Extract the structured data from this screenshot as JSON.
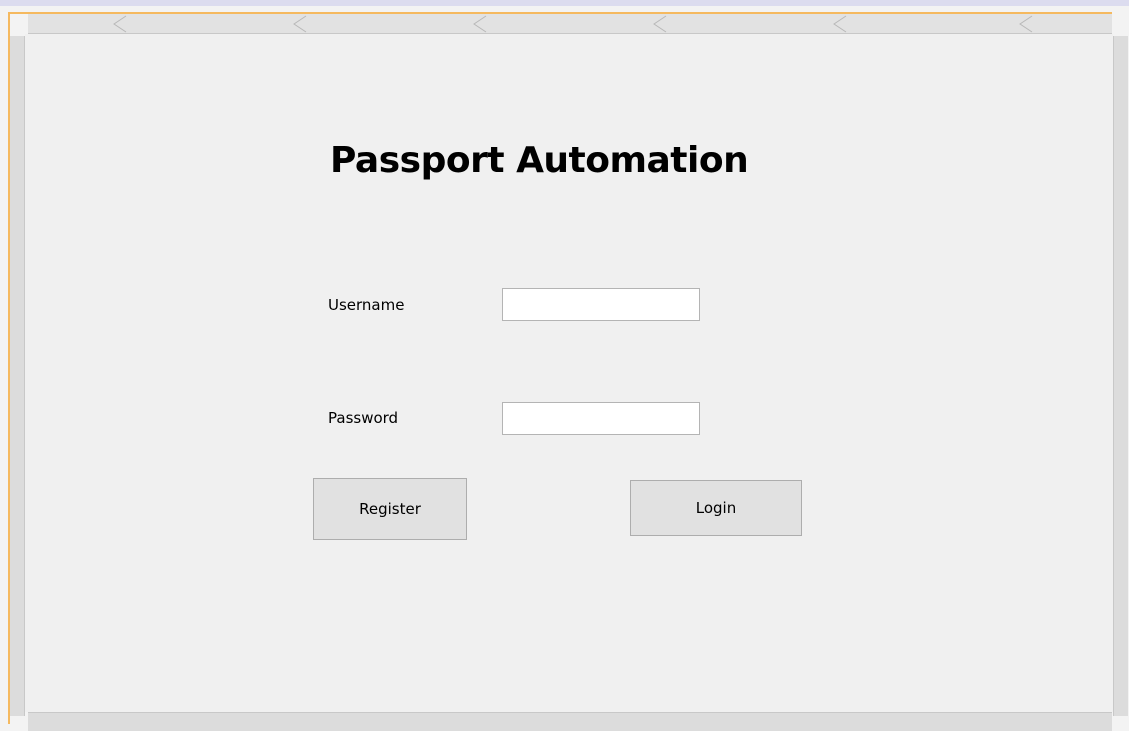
{
  "form": {
    "title": "Passport Automation",
    "username_label": "Username",
    "username_value": "",
    "password_label": "Password",
    "password_value": "",
    "register_label": "Register",
    "login_label": "Login"
  },
  "colors": {
    "selection_border": "#f5b95f",
    "panel_background": "#f0f0f0",
    "button_background": "#e1e1e1",
    "ruler_background": "#dcdcdc"
  }
}
